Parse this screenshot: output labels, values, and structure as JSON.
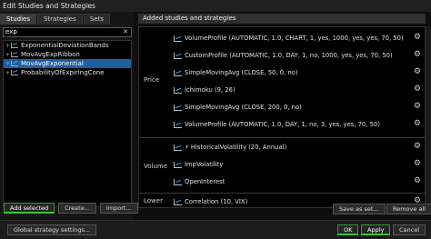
{
  "window": {
    "title": "Edit Studies and Strategies"
  },
  "tabs": [
    {
      "label": "Studies",
      "active": true
    },
    {
      "label": "Strategies",
      "active": false
    },
    {
      "label": "Sets",
      "active": false
    }
  ],
  "search": {
    "value": "exp",
    "clear_label": "✕"
  },
  "studies_list": [
    {
      "label": "ExponentialDeviationBands"
    },
    {
      "label": "MovAvgExpRibbon"
    },
    {
      "label": "MovAvgExponential",
      "selected": true
    },
    {
      "label": "ProbabilityOfExpiringCone"
    }
  ],
  "left_buttons": {
    "add_selected": "Add selected",
    "create": "Create...",
    "import": "Import..."
  },
  "added": {
    "header": "Added studies and strategies",
    "groups": [
      {
        "label": "Price",
        "items": [
          "VolumeProfile (AUTOMATIC, 1.0, CHART, 1, yes, 1000, yes, yes, 70, 50)",
          "CustomProfile (AUTOMATIC, 1.0, DAY, 1, no, 1000, yes, yes, 70, 50)",
          "SimpleMovingAvg (CLOSE, 50, 0, no)",
          "Ichimoku (9, 26)",
          "SimpleMovingAvg (CLOSE, 200, 0, no)",
          "VolumeProfile (AUTOMATIC, 1.0, DAY, 1, no, 3, yes, yes, 70, 50)"
        ]
      },
      {
        "label": "Volume",
        "items": [
          "HistoricalVolatility (20, Annual)",
          "ImpVolatility",
          "OpenInterest"
        ]
      },
      {
        "label": "Lower",
        "items": [
          "Correlation (10, VIX)"
        ]
      }
    ]
  },
  "right_buttons": {
    "save_as_set": "Save as set...",
    "remove_all": "Remove all"
  },
  "bottom_buttons": {
    "global_settings": "Global strategy settings...",
    "ok": "OK",
    "apply": "Apply",
    "cancel": "Cancel"
  },
  "icons": {
    "item": "study-chart-icon",
    "gear": "gear-icon",
    "bolt": "lightning-icon",
    "expand": "expand-icon"
  },
  "colors": {
    "selection": "#1e5fa0",
    "accent_green": "#3bc43b",
    "icon_blue": "#3ab0ff"
  }
}
